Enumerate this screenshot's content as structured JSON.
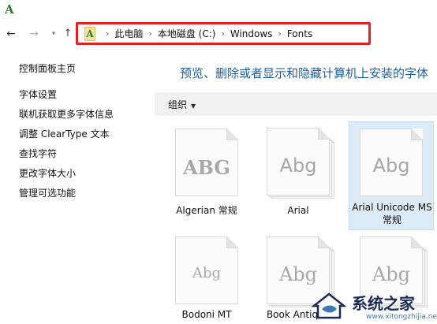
{
  "window": {
    "icon_glyph": "A"
  },
  "nav": {
    "back_glyph": "←",
    "forward_glyph": "→",
    "recent_glyph": "▾",
    "up_glyph": "↑"
  },
  "address": {
    "icon_glyph": "A",
    "separator": "›",
    "crumbs": [
      "此电脑",
      "本地磁盘 (C:)",
      "Windows",
      "Fonts"
    ]
  },
  "sidebar": {
    "home": "控制面板主页",
    "links": [
      "字体设置",
      "联机获取更多字体信息",
      "调整 ClearType 文本",
      "查找字符",
      "更改字体大小",
      "管理可选功能"
    ]
  },
  "heading": "预览、删除或者显示和隐藏计算机上安装的字体",
  "cmdbar": {
    "organize": "组织",
    "organize_caret": "▼"
  },
  "fonts": [
    {
      "sample": "ABG",
      "label": "Algerian 常规"
    },
    {
      "sample": "Abg",
      "label": "Arial"
    },
    {
      "sample": "Abg",
      "label": "Arial Unicode MS 常规"
    },
    {
      "sample": "Abg",
      "label": "Bodoni MT"
    },
    {
      "sample": "Abg",
      "label": "Book Antiqua"
    },
    {
      "sample": "Abg",
      "label": ""
    }
  ],
  "watermark": {
    "text": "系统之家",
    "url": "www.xitongzhijia.net"
  },
  "colors": {
    "accent": "#1f5fa6",
    "highlight": "#e02222",
    "selected": "#dcebf8"
  }
}
